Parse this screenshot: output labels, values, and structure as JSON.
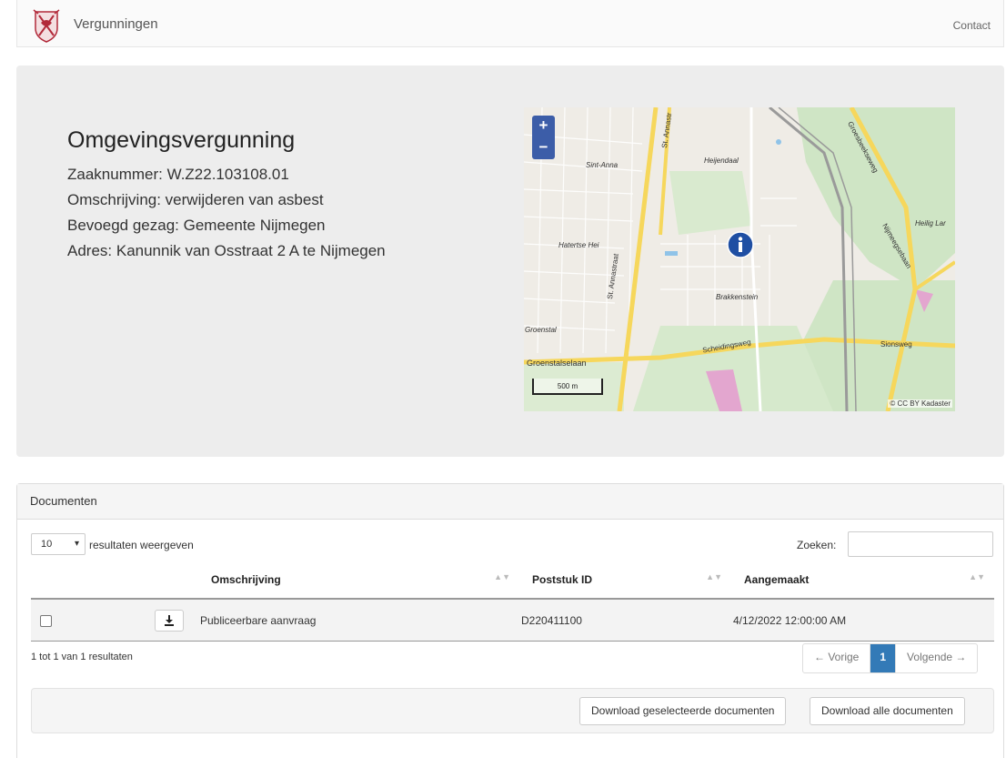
{
  "navbar": {
    "brand": "Vergunningen",
    "contact": "Contact",
    "logo_color": "#b22a3a"
  },
  "hero": {
    "title": "Omgevingsvergunning",
    "zaaknummer": "Zaaknummer: W.Z22.103108.01",
    "omschrijving": "Omschrijving: verwijderen van asbest",
    "bevoegd_gezag": "Bevoegd gezag: Gemeente Nijmegen",
    "adres": "Adres: Kanunnik van Osstraat 2 A te Nijmegen"
  },
  "map": {
    "zoom_in": "+",
    "zoom_out": "−",
    "scale": "500 m",
    "attribution": "© CC BY Kadaster",
    "labels": {
      "sint_anna": "Sint-Anna",
      "heijendaal": "Heijendaal",
      "heilig_land": "Heilig Lar",
      "hatertse_hei": "Hatertse Hei",
      "brakkenstein": "Brakkenstein",
      "groenstal": "Groenstal",
      "groenstalselaan": "Groenstalselaan",
      "st_annastraat": "St. Annastraat",
      "st_annastraat_2": "St. Annastr",
      "scheidingsweg": "Scheidingsweg",
      "sionsweg": "Sionsweg",
      "groesbeekseweg": "Groesbeekseweg",
      "nijmeegsebaan": "Nijmeegsebaan"
    }
  },
  "documents": {
    "heading": "Documenten",
    "length_value": "10",
    "length_label": "resultaten weergeven",
    "search_label": "Zoeken:",
    "search_value": "",
    "columns": [
      "Omschrijving",
      "Poststuk ID",
      "Aangemaakt"
    ],
    "rows": [
      {
        "omschrijving": "Publiceerbare aanvraag",
        "poststuk_id": "D220411100",
        "aangemaakt": "4/12/2022 12:00:00 AM"
      }
    ],
    "info": "1 tot 1 van 1 resultaten",
    "pager": {
      "prev": "← Vorige",
      "current": "1",
      "next": "Volgende →"
    },
    "btn_selected": "Download geselecteerde documenten",
    "btn_all": "Download alle documenten"
  }
}
